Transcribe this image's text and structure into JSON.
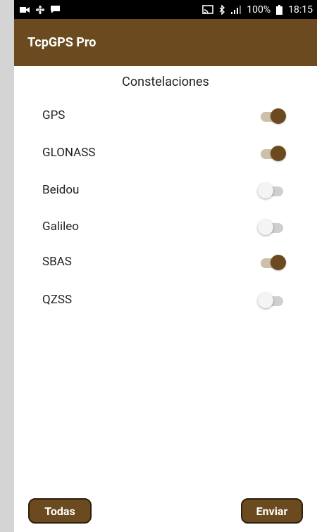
{
  "status_bar": {
    "left_icons": [
      "video-call-icon",
      "fan-icon",
      "message-icon"
    ],
    "right_icons": [
      "cast-icon",
      "bluetooth-icon",
      "signal-icon",
      "battery-icon"
    ],
    "battery": "100%",
    "time": "18:15"
  },
  "app": {
    "title": "TcpGPS Pro",
    "accent": "#6b4a1f"
  },
  "section": {
    "title": "Constelaciones"
  },
  "constellations": [
    {
      "label": "GPS",
      "enabled": true
    },
    {
      "label": "GLONASS",
      "enabled": true
    },
    {
      "label": "Beidou",
      "enabled": false
    },
    {
      "label": "Galileo",
      "enabled": false
    },
    {
      "label": "SBAS",
      "enabled": true
    },
    {
      "label": "QZSS",
      "enabled": false
    }
  ],
  "buttons": {
    "todas": "Todas",
    "enviar": "Enviar"
  }
}
